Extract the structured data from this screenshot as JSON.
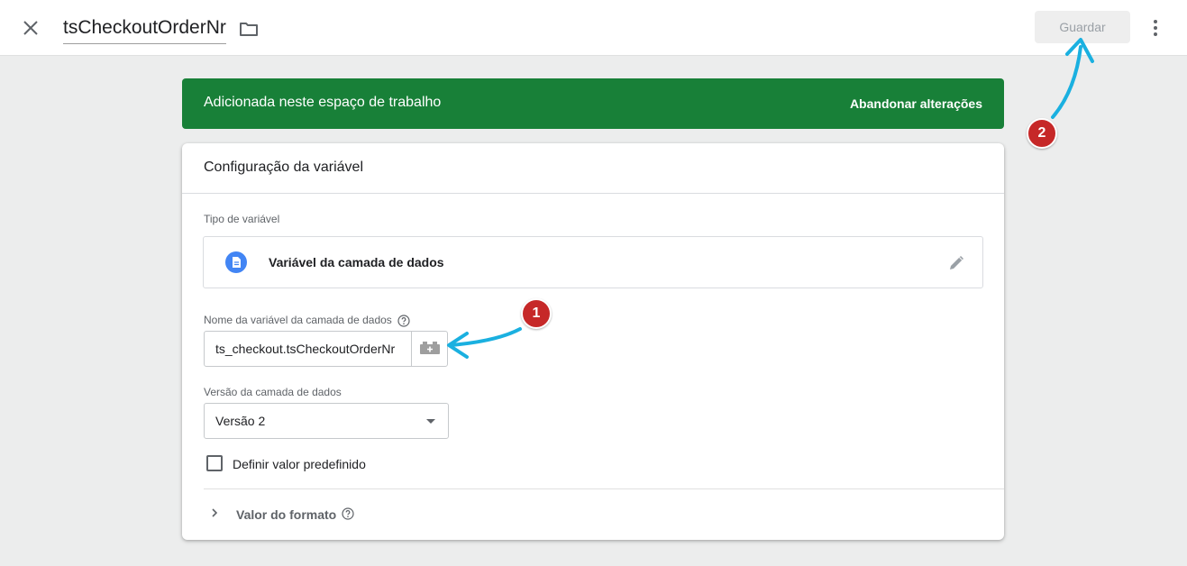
{
  "header": {
    "title": "tsCheckoutOrderNr",
    "save_label": "Guardar",
    "close_icon": "close-icon",
    "folder_icon": "folder-icon",
    "more_icon": "more-vert-icon"
  },
  "banner": {
    "message": "Adicionada neste espaço de trabalho",
    "action": "Abandonar alterações",
    "color": "#188038"
  },
  "card": {
    "title": "Configuração da variável",
    "variable_type": {
      "label": "Tipo de variável",
      "value": "Variável da camada de dados",
      "icon": "document-icon",
      "icon_color": "#4285f4"
    },
    "name_field": {
      "label": "Nome da variável da camada de dados",
      "value": "ts_checkout.tsCheckoutOrderNr"
    },
    "version_field": {
      "label": "Versão da camada de dados",
      "value": "Versão 2"
    },
    "default_checkbox": {
      "label": "Definir valor predefinido",
      "checked": false
    },
    "format": {
      "label": "Valor do formato"
    }
  },
  "annotations": {
    "badge_1": "1",
    "badge_2": "2",
    "badge_color": "#c62828",
    "arrow_color": "#1ab0e0"
  }
}
